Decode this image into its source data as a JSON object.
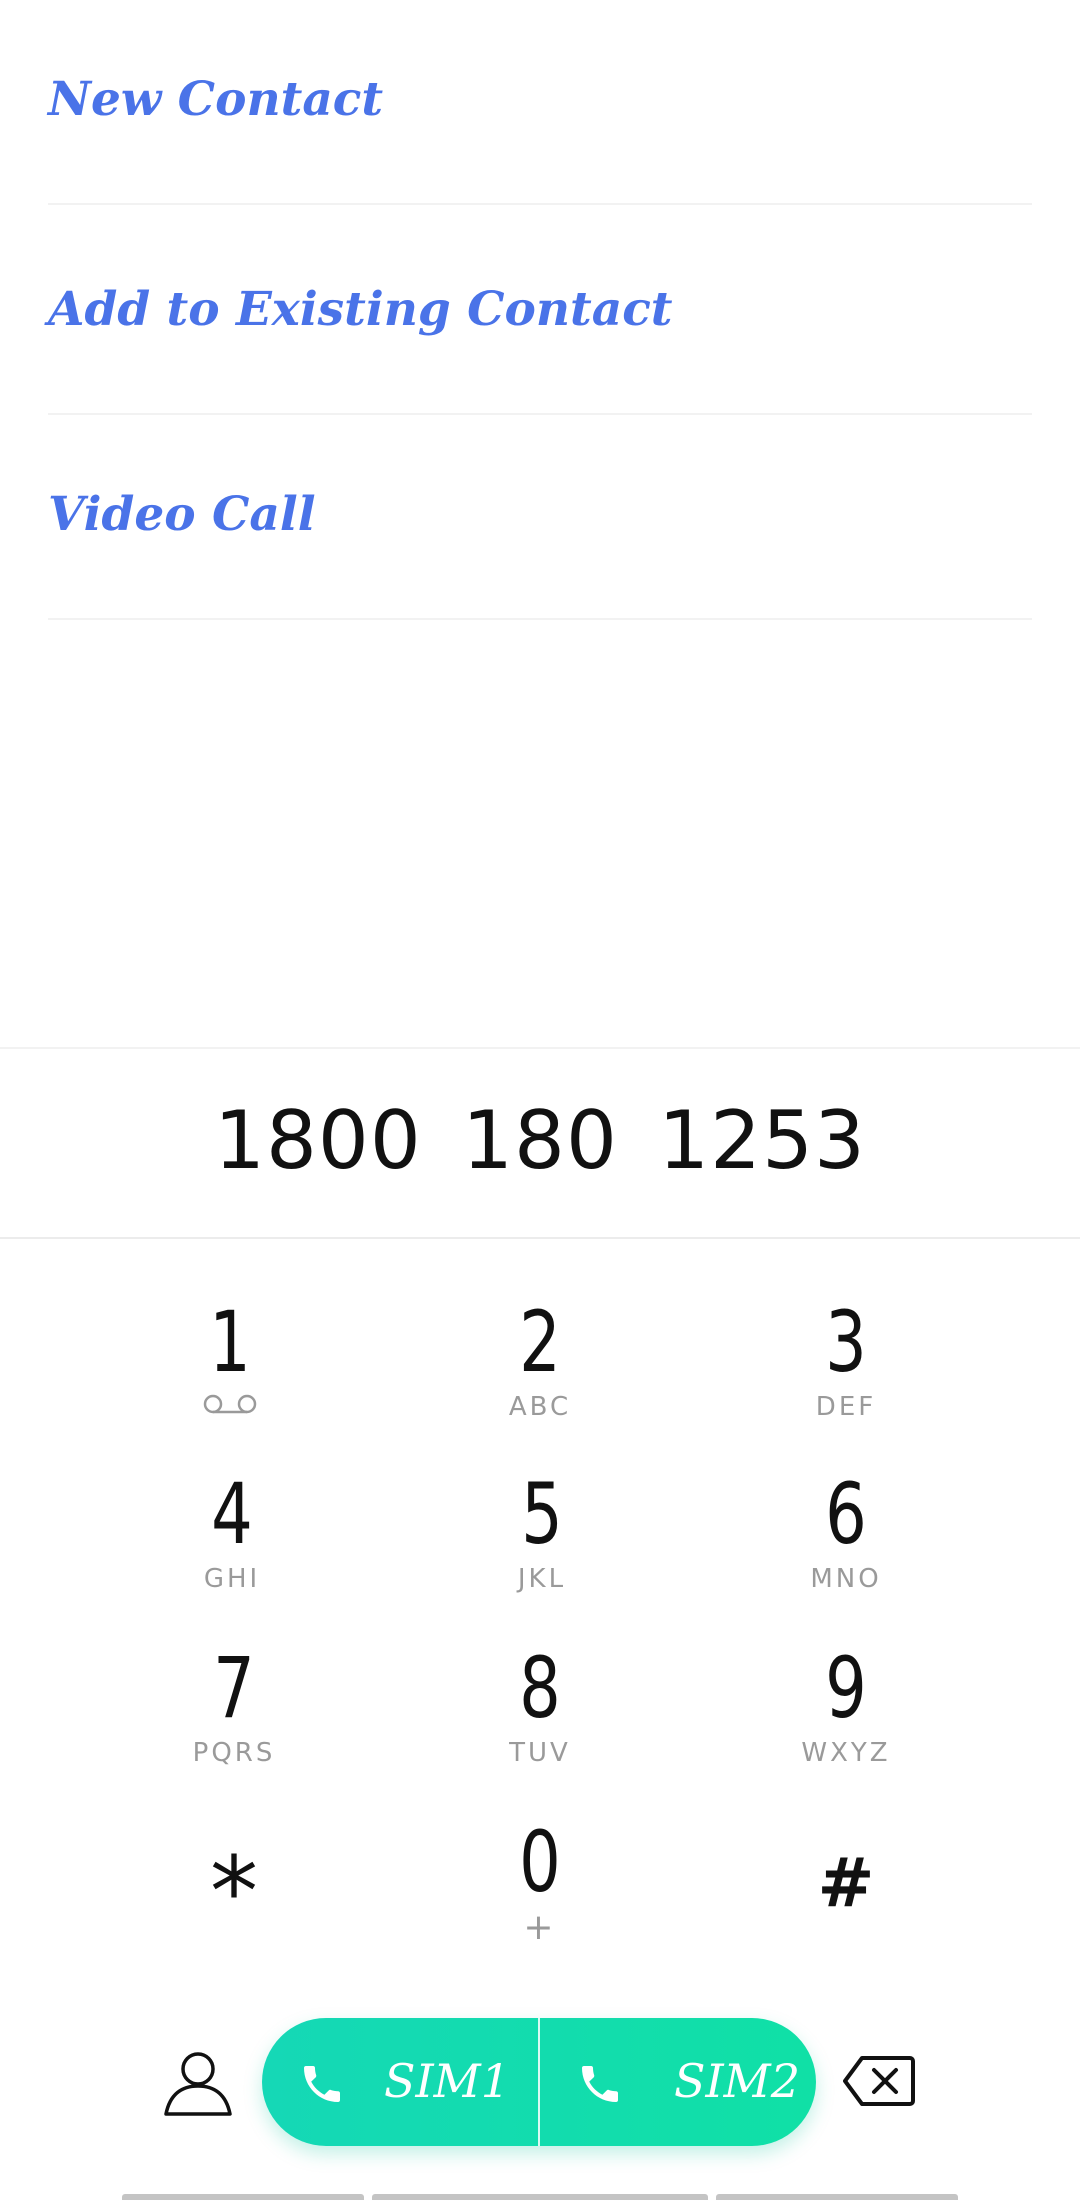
{
  "menu": {
    "items": [
      {
        "label": "New Contact"
      },
      {
        "label": "Add to Existing Contact"
      },
      {
        "label": "Video Call"
      }
    ]
  },
  "dialer": {
    "number": "1800 180 1253"
  },
  "keypad": {
    "keys": [
      {
        "digit": "1",
        "letters": "",
        "icon": "voicemail-icon"
      },
      {
        "digit": "2",
        "letters": "ABC"
      },
      {
        "digit": "3",
        "letters": "DEF"
      },
      {
        "digit": "4",
        "letters": "GHI"
      },
      {
        "digit": "5",
        "letters": "JKL"
      },
      {
        "digit": "6",
        "letters": "MNO"
      },
      {
        "digit": "7",
        "letters": "PQRS"
      },
      {
        "digit": "8",
        "letters": "TUV"
      },
      {
        "digit": "9",
        "letters": "WXYZ"
      },
      {
        "digit": "*",
        "letters": ""
      },
      {
        "digit": "0",
        "letters": "+"
      },
      {
        "digit": "#",
        "letters": ""
      }
    ]
  },
  "actions": {
    "contacts_icon": "person-icon",
    "sim1_label": "SIM1",
    "sim2_label": "SIM2",
    "phone_icon": "phone-icon",
    "backspace_icon": "backspace-icon"
  },
  "colors": {
    "link": "#4a73e8",
    "call_button": "#12dcae",
    "key_digit": "#111111",
    "key_letters": "#9a9a9a"
  }
}
